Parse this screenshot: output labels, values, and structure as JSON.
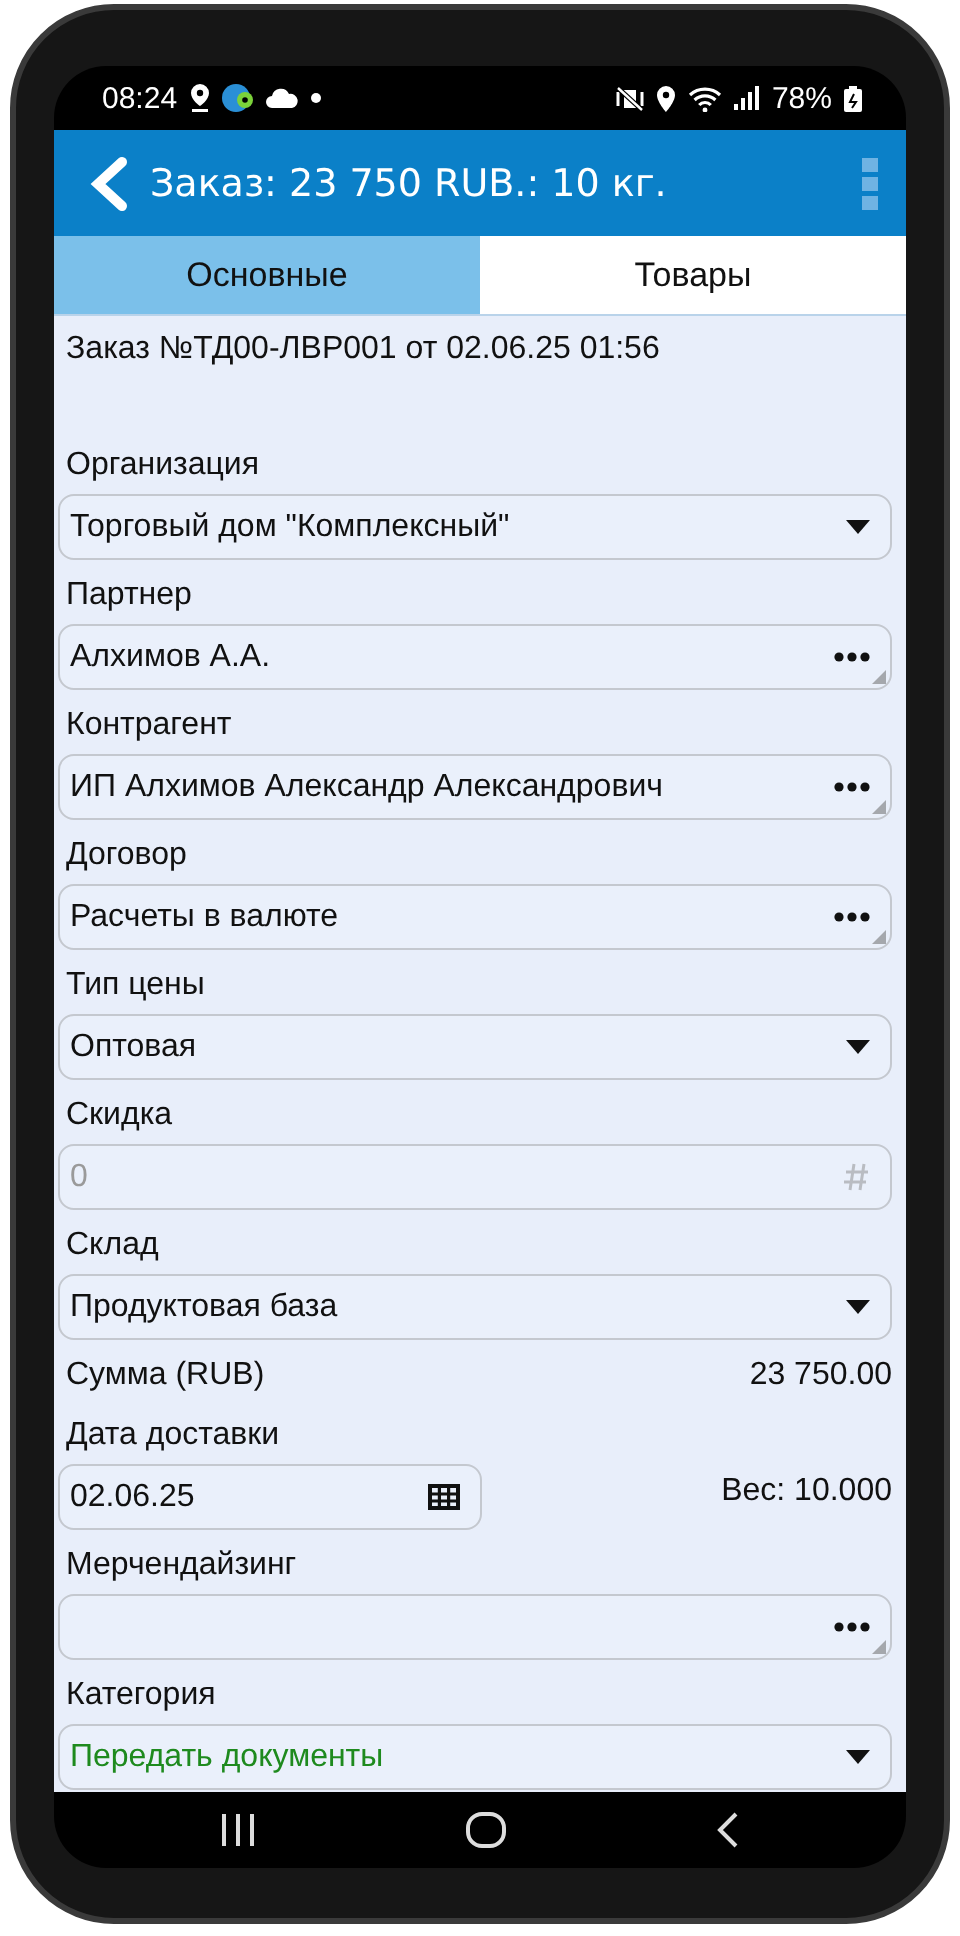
{
  "status_bar": {
    "time": "08:24",
    "battery": "78%"
  },
  "app_bar": {
    "title": "Заказ: 23 750 RUB.: 10 кг."
  },
  "tabs": [
    {
      "label": "Основные",
      "selected": true
    },
    {
      "label": "Товары",
      "selected": false
    }
  ],
  "order_line": "Заказ №ТД00-ЛВР001 от 02.06.25 01:56",
  "fields": [
    {
      "kind": "dropdown",
      "label": "Организация",
      "value": "Торговый дом \"Комплексный\"",
      "disabled": false
    },
    {
      "kind": "choice",
      "label": "Партнер",
      "value": "Алхимов А.А.",
      "disabled": false
    },
    {
      "kind": "choice",
      "label": "Контрагент",
      "value": "ИП Алхимов Александр Александрович",
      "disabled": false
    },
    {
      "kind": "choice",
      "label": "Договор",
      "value": "Расчеты в валюте",
      "disabled": false
    },
    {
      "kind": "dropdown",
      "label": "Тип цены",
      "value": "Оптовая",
      "disabled": false
    },
    {
      "kind": "number",
      "label": "Скидка",
      "value": "0",
      "disabled": true
    },
    {
      "kind": "dropdown",
      "label": "Склад",
      "value": "Продуктовая база",
      "disabled": false
    },
    {
      "kind": "sum",
      "label": "Сумма (RUB)",
      "value": "23 750.00"
    },
    {
      "kind": "date",
      "label": "Дата доставки",
      "value": "02.06.25",
      "weight": "Вес: 10.000",
      "disabled": false
    },
    {
      "kind": "choice",
      "label": "Мерчендайзинг",
      "disabled": false
    },
    {
      "kind": "dropdown",
      "label": "Категория",
      "value": "Передать документы",
      "disabled": false,
      "color": "#1e8a1e"
    }
  ]
}
